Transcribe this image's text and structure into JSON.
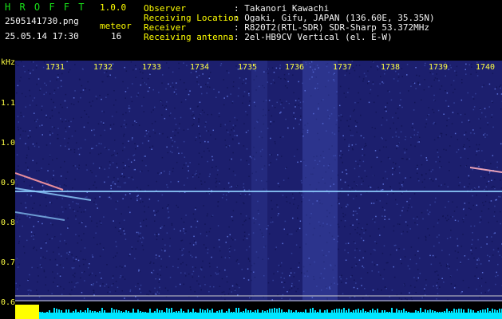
{
  "header": {
    "app_name": "H R O F F T",
    "version": "1.0.0",
    "filename": "2505141730.png",
    "datetime": "25.05.14 17:30",
    "mode_label": "meteor",
    "count": "16",
    "observer_label": "Observer",
    "observer_value": ": Takanori Kawachi",
    "location_label": "Receiving Location",
    "location_value": ": Ogaki, Gifu, JAPAN (136.60E, 35.35N)",
    "receiver_label": "Receiver",
    "receiver_value": ": R820T2(RTL-SDR) SDR-Sharp 53.372MHz",
    "antenna_label": "Receiving antenna",
    "antenna_value": ": 2el-HB9CV Vertical (el. E-W)"
  },
  "axis": {
    "y_unit": "kHz",
    "y_ticks": [
      "1.1",
      "1.0",
      "0.9",
      "0.8",
      "0.7",
      "0.6"
    ],
    "x_ticks": [
      "1731",
      "1732",
      "1733",
      "1734",
      "1735",
      "1736",
      "1737",
      "1738",
      "1739",
      "1740"
    ]
  },
  "colors": {
    "background": "#1c1f6e",
    "signal": "#8fd0ff",
    "header_green": "#19e019",
    "header_yellow": "#ffff00",
    "level_bar": "#00e5ff",
    "level_bar_left": "#ffff00"
  }
}
